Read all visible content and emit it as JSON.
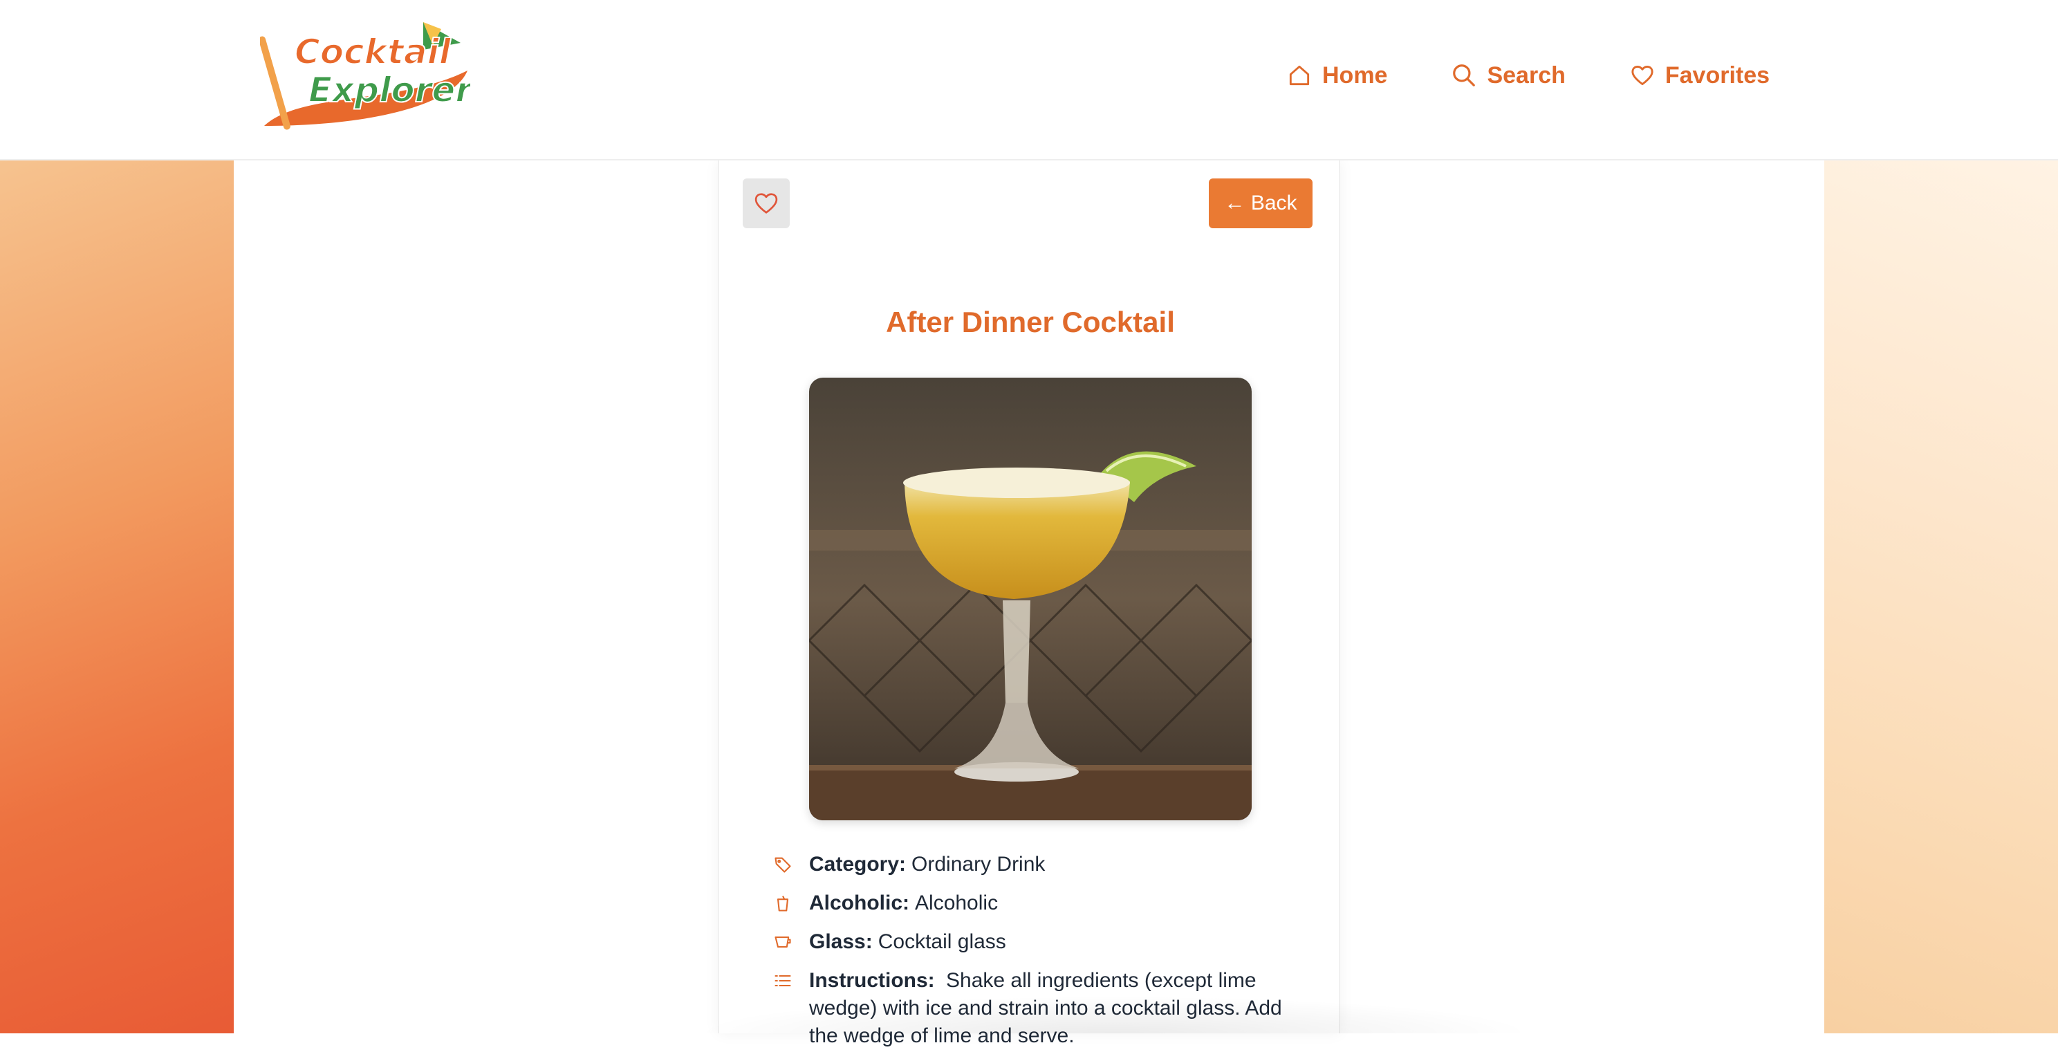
{
  "header": {
    "logo_text_line1": "Cocktail",
    "logo_text_line2": "Explorer",
    "nav": [
      {
        "label": "Home",
        "icon": "home-icon"
      },
      {
        "label": "Search",
        "icon": "search-icon"
      },
      {
        "label": "Favorites",
        "icon": "heart-icon"
      }
    ]
  },
  "card": {
    "back_label": "← Back",
    "title": "After Dinner Cocktail",
    "details": [
      {
        "label": "Category:",
        "value": "Ordinary Drink",
        "icon": "tag-icon"
      },
      {
        "label": "Alcoholic:",
        "value": "Alcoholic",
        "icon": "cup-icon"
      },
      {
        "label": "Glass:",
        "value": "Cocktail glass",
        "icon": "glass-icon"
      },
      {
        "label": "Instructions:",
        "value": "Shake all ingredients (except lime wedge) with ice and strain into a cocktail glass. Add the wedge of lime and serve.",
        "icon": "list-icon"
      }
    ]
  },
  "colors": {
    "accent": "#e06a2b",
    "button": "#ea7a33"
  }
}
